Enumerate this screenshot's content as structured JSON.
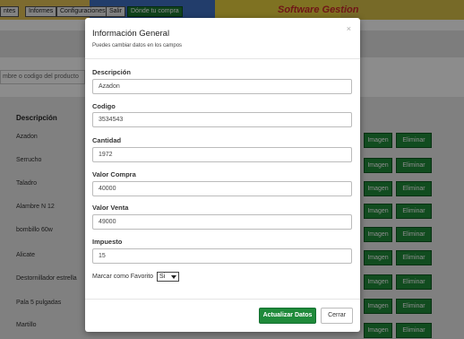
{
  "background": {
    "nav": {
      "items": [
        "ntes",
        "Informes",
        "Configuraciones",
        "Salir",
        "Dónde tu compra"
      ],
      "brand": "Software Gestion"
    },
    "search_placeholder": "mbre o codigo del producto",
    "table_header": "Descripción",
    "rows": [
      "Azadon",
      "Serrucho",
      "Taladro",
      "Alambre N 12",
      "bombillo 60w",
      "Alicate",
      "Destornillador estrella",
      "Pala 5 pulgadas",
      "Martillo"
    ],
    "btn_image": "Imagen",
    "btn_delete": "Eliminar"
  },
  "modal": {
    "title": "Información General",
    "subtitle": "Puedes cambiar datos en los campos",
    "close_icon": "×",
    "fields": [
      {
        "label": "Descripción",
        "value": "Azadon"
      },
      {
        "label": "Codigo",
        "value": "3534543"
      },
      {
        "label": "Cantidad",
        "value": "1972"
      },
      {
        "label": "Valor Compra",
        "value": "40000"
      },
      {
        "label": "Valor Venta",
        "value": "49000"
      },
      {
        "label": "Impuesto",
        "value": "15"
      }
    ],
    "favorite_label": "Marcar como Favorito",
    "favorite_value": "Si",
    "update_button": "Actualizar Datos",
    "close_button": "Cerrar"
  }
}
